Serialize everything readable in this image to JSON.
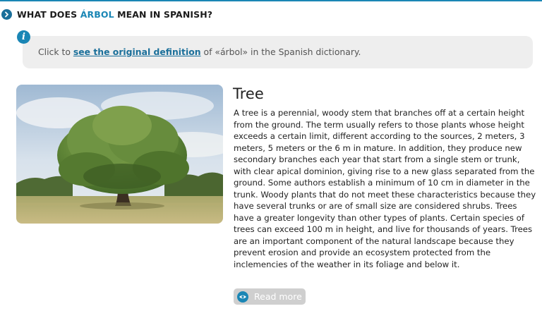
{
  "section": {
    "title_prefix": "WHAT DOES ",
    "title_word": "ÁRBOL",
    "title_suffix": " MEAN IN SPANISH?"
  },
  "info": {
    "icon_glyph": "i",
    "text_before": "Click to ",
    "link_text": "see the original definition",
    "text_after": " of «árbol» in the Spanish dictionary."
  },
  "image": {
    "description_icon": "tree-photo"
  },
  "entry": {
    "word": "Tree",
    "definition": "A tree is a perennial, woody stem that branches off at a certain height from the ground. The term usually refers to those plants whose height exceeds a certain limit, different according to the sources, 2 meters, 3 meters, 5 meters or the 6 m in mature. In addition, they produce new secondary branches each year that start from a single stem or trunk, with clear apical dominion, giving rise to a new glass separated from the ground. Some authors establish a minimum of 10 cm in diameter in the trunk. Woody plants that do not meet these characteristics because they have several trunks or are of small size are considered shrubs. Trees have a greater longevity than other types of plants. Certain species of trees can exceed 100 m in height, and live for thousands of years. Trees are an important component of the natural landscape because they prevent erosion and provide an ecosystem protected from the inclemencies of the weather in its foliage and below it.",
    "read_more_label": "Read more"
  },
  "colors": {
    "accent": "#1a86b5",
    "accent_dark": "#1a6f9a",
    "info_bg": "#eeeeee",
    "button_bg": "#cfcfcf"
  }
}
